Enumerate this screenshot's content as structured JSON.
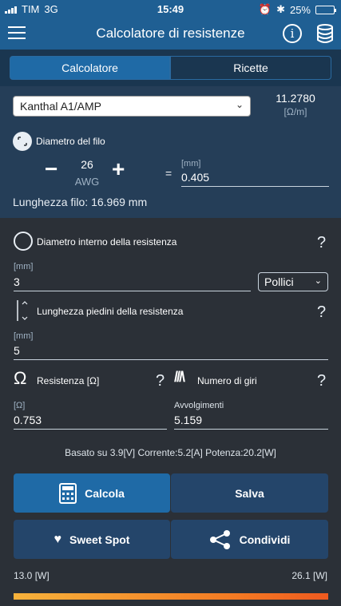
{
  "status": {
    "carrier": "TIM",
    "network": "3G",
    "time": "15:49",
    "battery": "25%",
    "battery_level": 0.25
  },
  "header": {
    "title": "Calcolatore di resistenze",
    "info_icon": "info-icon",
    "db_icon": "database-icon"
  },
  "tabs": [
    {
      "label": "Calcolatore",
      "active": true
    },
    {
      "label": "Ricette",
      "active": false
    }
  ],
  "material": {
    "selected": "Kanthal A1/AMP",
    "resistivity_value": "11.2780",
    "resistivity_unit": "[Ω/m]"
  },
  "wire": {
    "label": "Diametro del filo",
    "awg_value": "26",
    "awg_unit": "AWG",
    "equals": "=",
    "mm_unit": "[mm]",
    "mm_value": "0.405",
    "length_text": "Lunghezza filo: 16.969 mm"
  },
  "inner_diameter": {
    "label": "Diametro interno della resistenza",
    "help": "?",
    "unit": "[mm]",
    "value": "3",
    "unit_select": "Pollici"
  },
  "leg_length": {
    "label": "Lunghezza piedini della resistenza",
    "help": "?",
    "unit": "[mm]",
    "value": "5"
  },
  "resistance": {
    "label": "Resistenza [Ω]",
    "help": "?",
    "unit": "[Ω]",
    "value": "0.753"
  },
  "coils": {
    "label": "Numero di giri",
    "help": "?",
    "unit": "Avvolgimenti",
    "value": "5.159"
  },
  "summary": "Basato su 3.9[V] Corrente:5.2[A] Potenza:20.2[W]",
  "buttons": {
    "calc": "Calcola",
    "save": "Salva",
    "sweet": "Sweet Spot",
    "share": "Condividi"
  },
  "power": {
    "min": "13.0 [W]",
    "max": "26.1 [W]"
  },
  "colors": {
    "header": "#1f5f93",
    "accent": "#1f6aa6",
    "panel": "#253e58",
    "bar_start": "#f7b23b",
    "bar_end": "#ef5a1f"
  }
}
